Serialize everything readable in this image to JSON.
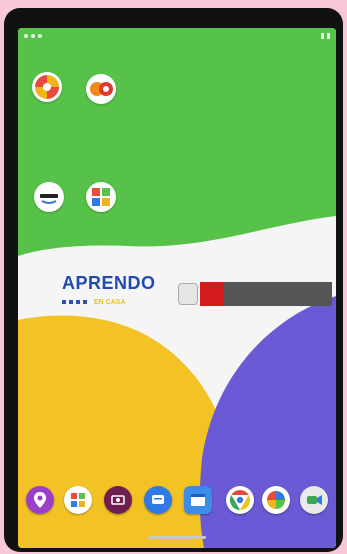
{
  "logo": {
    "title": "APRENDO",
    "subtitle": "EN CASA"
  },
  "colors": {
    "wallpaper_green": "#57c24a",
    "wallpaper_yellow": "#f3c325",
    "wallpaper_purple": "#6b5ad6",
    "aprendo_blue": "#1f4bb0",
    "gov_red": "#d31b1b"
  },
  "home_icons": [
    {
      "icon": "compass-multicolor-icon"
    },
    {
      "icon": "orange-circles-app-icon"
    },
    {
      "icon": "amazon-app-icon"
    },
    {
      "icon": "colorful-squares-app-icon"
    }
  ],
  "dock_icons": [
    {
      "icon": "maps-location-icon"
    },
    {
      "icon": "puzzle-pieces-icon"
    },
    {
      "icon": "purple-media-app-icon"
    },
    {
      "icon": "blue-chat-app-icon"
    },
    {
      "icon": "blue-calendar-app-icon"
    },
    {
      "icon": "chrome-icon"
    },
    {
      "icon": "pinwheel-app-icon"
    },
    {
      "icon": "duo-video-icon"
    }
  ]
}
